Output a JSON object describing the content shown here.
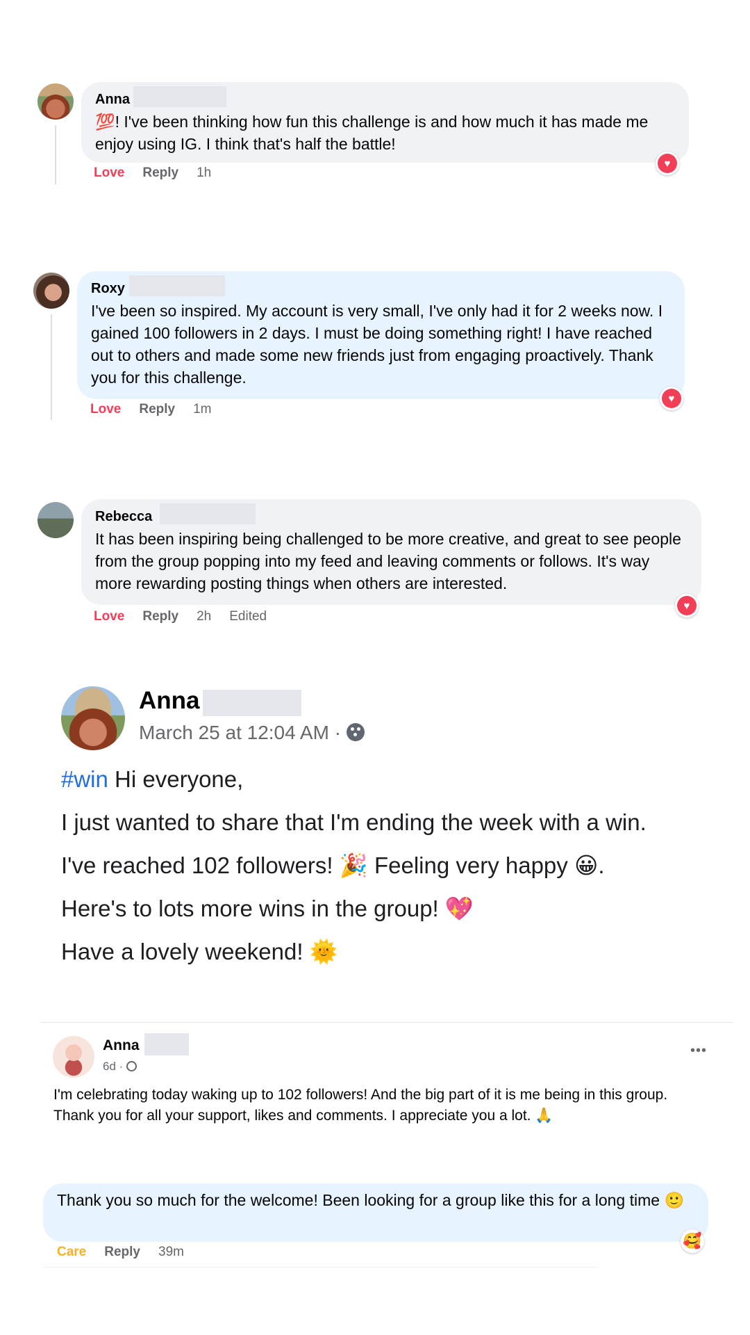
{
  "comments": [
    {
      "name": "Anna",
      "emoji": "💯",
      "text": "! I've been thinking how fun this challenge is and how much it has made me enjoy using IG. I think that's half the battle!",
      "reaction_label": "Love",
      "reply_label": "Reply",
      "time": "1h"
    },
    {
      "name": "Roxy",
      "text": "I've been so inspired. My account is very small, I've only had it for 2 weeks now. I gained 100 followers in 2 days. I must be doing something right! I have reached out to others and made some new friends just from engaging proactively. Thank you for this challenge.",
      "reaction_label": "Love",
      "reply_label": "Reply",
      "time": "1m"
    },
    {
      "name": "Rebecca",
      "text": "It has been inspiring being challenged to be more creative, and great to see people from the group popping into my feed and leaving comments or follows. It's way more rewarding posting things when others are interested.",
      "reaction_label": "Love",
      "reply_label": "Reply",
      "time": "2h",
      "edited": "Edited"
    }
  ],
  "post": {
    "name": "Anna",
    "timestamp": "March 25 at 12:04 AM · ",
    "hashtag": "#win",
    "line1_rest": " Hi everyone,",
    "line2": "I just wanted to share that I'm ending the week with a win.",
    "line3_a": "I've reached 102 followers! ",
    "line3_emoji1": "🎉",
    "line3_b": " Feeling very happy ",
    "line3_emoji2": "😀",
    "line3_c": ".",
    "line4": "Here's to lots more wins in the group! ",
    "line4_emoji": "💖",
    "line5": "Have a lovely weekend! ",
    "line5_emoji": "🌞"
  },
  "post2": {
    "name": "Anna",
    "time": "6d · ",
    "more_label": "•••",
    "text": "I'm celebrating today waking up to 102 followers! And the big part of it is me being in this group. Thank you for all your support, likes and comments. I appreciate you a lot. ",
    "emoji": "🙏"
  },
  "last_comment": {
    "text": "Thank you so much for the welcome! Been looking for a group like this for a long time ",
    "emoji": "🙂",
    "reaction_label": "Care",
    "reply_label": "Reply",
    "time": "39m",
    "reaction_emoji": "🥰"
  },
  "colors": {
    "love": "#f33e58",
    "care": "#f7b125",
    "hashtag": "#216fdb",
    "bubble_gray": "#f0f2f5",
    "bubble_blue": "#e7f3ff"
  }
}
